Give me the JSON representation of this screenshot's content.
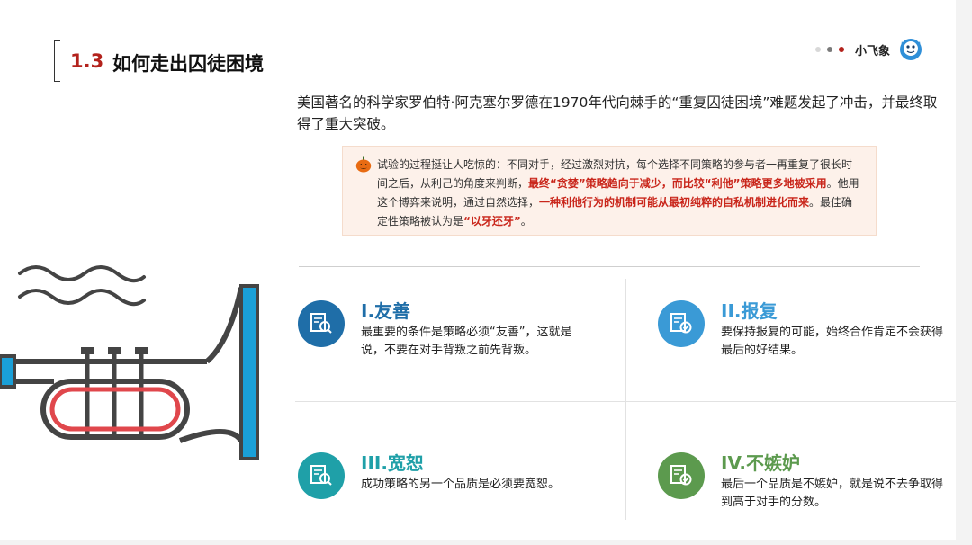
{
  "header": {
    "section_number": "1.3",
    "title": "如何走出囚徒困境",
    "brand_name": "小飞象",
    "dot_colors": [
      "#d8d8d8",
      "#7a7a7a",
      "#b3221c"
    ]
  },
  "intro": "美国著名的科学家罗伯特·阿克塞尔罗德在1970年代向棘手的“重复囚徒困境”难题发起了冲击，并最终取得了重大突破。",
  "note": {
    "icon": "pumpkin-icon",
    "text_1": "试验的过程挺让人吃惊的：不同对手，经过激烈对抗，每个选择不同策略的参与者一再重复了很长时间之后，从利己的角度来判断，",
    "highlight_1": "最终“贪婪”策略趋向于减少，而比较“利他”策略更多地被采用",
    "text_2": "。他用这个博弈来说明，通过自然选择，",
    "highlight_2": "一种利他行为的机制可能从最初纯粹的自私机制进化而来",
    "text_3": "。最佳确定性策略被认为是",
    "highlight_3": "“以牙还牙”",
    "text_4": "。"
  },
  "principles": [
    {
      "icon": "document-search-icon",
      "title": "I.友善",
      "description": "最重要的条件是策略必须“友善”，这就是说，不要在对手背叛之前先背叛。",
      "color": "#1f6ea8"
    },
    {
      "icon": "document-check-icon",
      "title": "II.报复",
      "description": "要保持报复的可能，始终合作肯定不会获得最后的好结果。",
      "color": "#3a9ad6"
    },
    {
      "icon": "document-search-icon",
      "title": "III.宽恕",
      "description": "成功策略的另一个品质是必须要宽恕。",
      "color": "#1fa0a8"
    },
    {
      "icon": "document-check-icon",
      "title": "IV.不嫉妒",
      "description": "最后一个品质是不嫉妒，就是说不去争取得到高于对手的分数。",
      "color": "#5c9a4e"
    }
  ],
  "illustration": {
    "icon": "trumpet-icon"
  }
}
